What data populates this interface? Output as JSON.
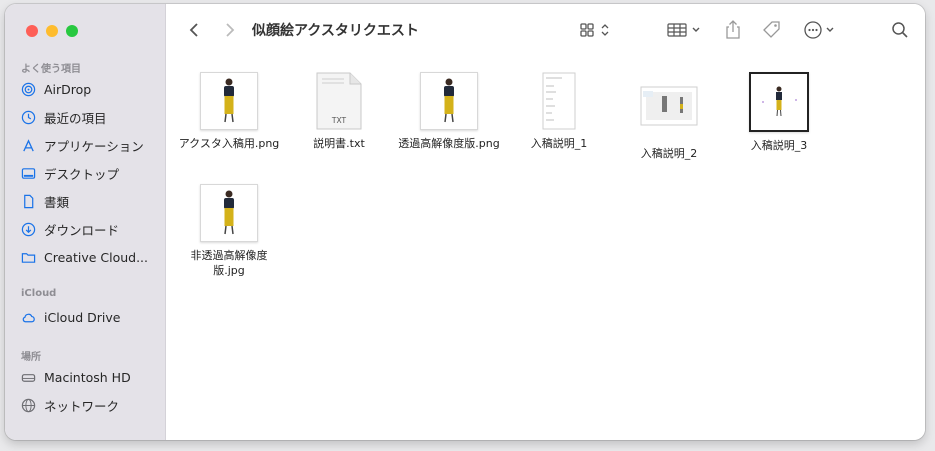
{
  "window": {
    "title": "似顔絵アクスタリクエスト"
  },
  "sidebar": {
    "favorites_title": "よく使う項目",
    "favorites": [
      {
        "label": "AirDrop",
        "icon": "airdrop-icon"
      },
      {
        "label": "最近の項目",
        "icon": "clock-icon"
      },
      {
        "label": "アプリケーション",
        "icon": "applications-icon"
      },
      {
        "label": "デスクトップ",
        "icon": "desktop-icon"
      },
      {
        "label": "書類",
        "icon": "document-icon"
      },
      {
        "label": "ダウンロード",
        "icon": "download-icon"
      },
      {
        "label": "Creative Cloud...",
        "icon": "folder-icon"
      }
    ],
    "icloud_title": "iCloud",
    "icloud": [
      {
        "label": "iCloud Drive",
        "icon": "cloud-icon"
      }
    ],
    "locations_title": "場所",
    "locations": [
      {
        "label": "Macintosh HD",
        "icon": "disk-icon"
      },
      {
        "label": "ネットワーク",
        "icon": "globe-icon"
      }
    ]
  },
  "files": [
    {
      "name": "アクスタ入稿用.png",
      "kind": "figure"
    },
    {
      "name": "説明書.txt",
      "kind": "txt",
      "badge": "TXT"
    },
    {
      "name": "透過高解像度版.png",
      "kind": "figure"
    },
    {
      "name": "入稿説明_1",
      "kind": "doc"
    },
    {
      "name": "入稿説明_2",
      "kind": "landscape"
    },
    {
      "name": "入稿説明_3",
      "kind": "bordered"
    },
    {
      "name": "非透過高解像度版.jpg",
      "kind": "figure"
    }
  ],
  "colors": {
    "accent": "#1a73e8",
    "sidebar_bg": "#e4e2e8",
    "figure_yellow": "#d4b21a"
  }
}
